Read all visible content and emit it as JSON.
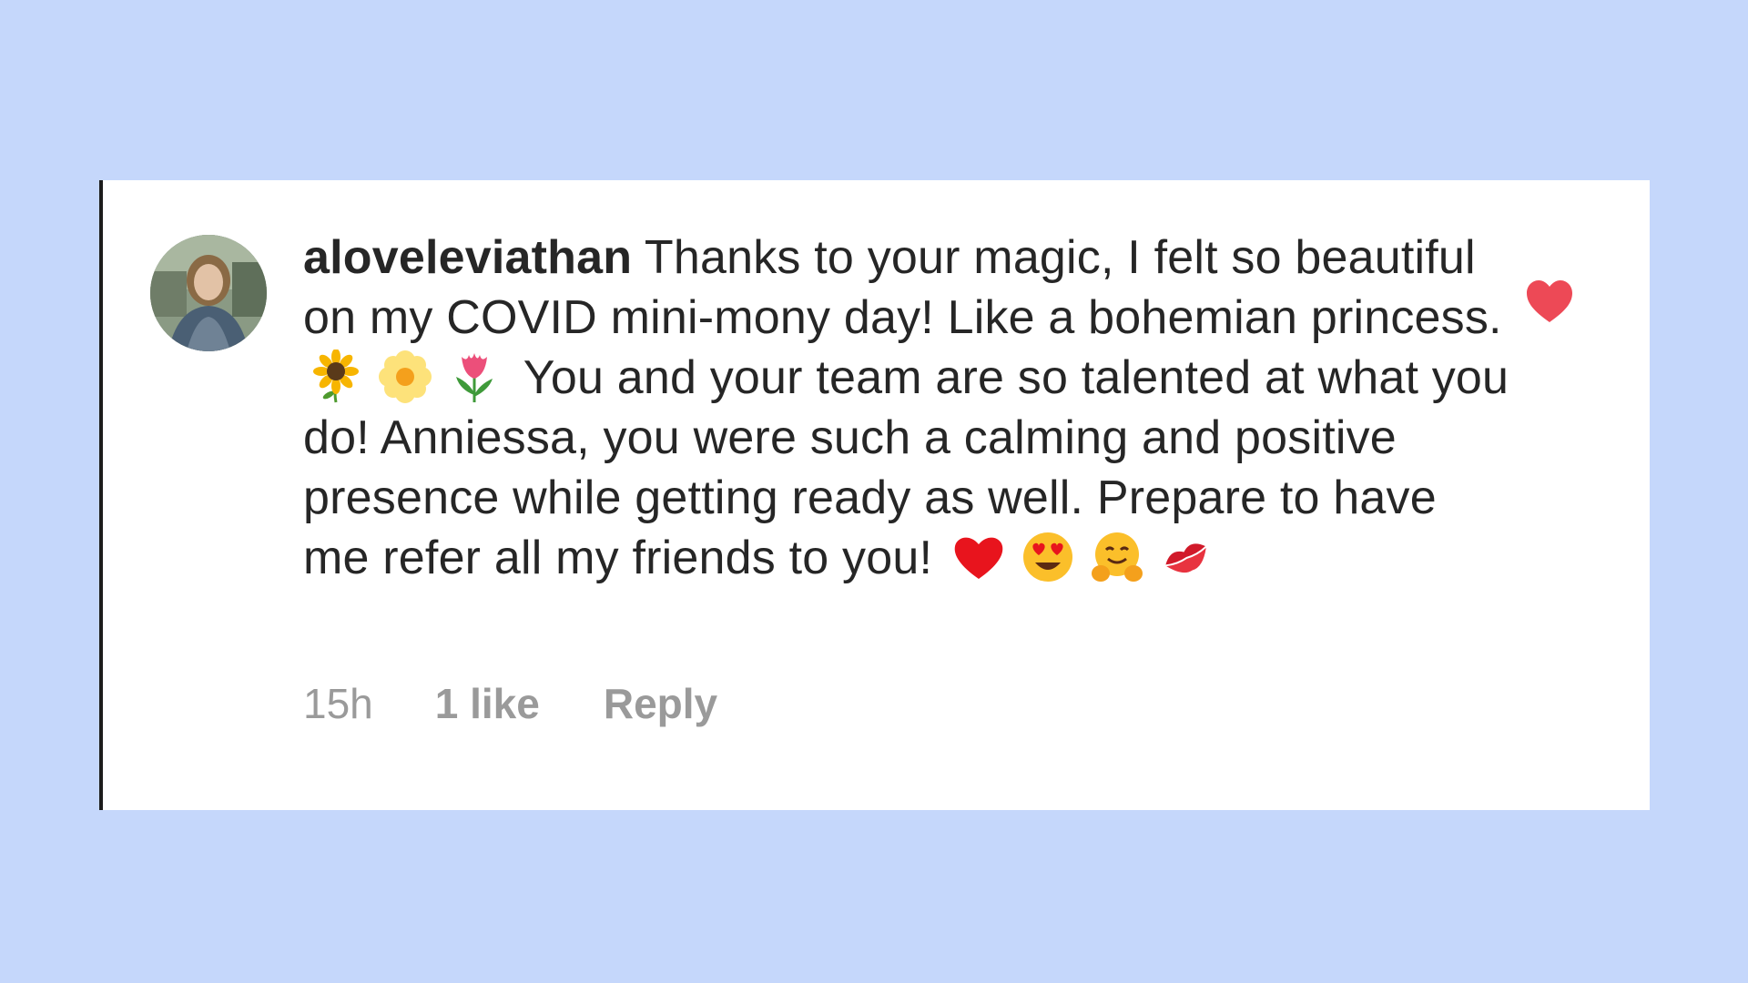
{
  "comment": {
    "username": "aloveleviathan",
    "text_part1": " Thanks to your magic, I felt so beautiful on my COVID mini-mony day! Like a bohemian princess. ",
    "emojis_inline": [
      "sunflower-emoji",
      "blossom-emoji",
      "tulip-emoji"
    ],
    "text_part2": " You and your team are so talented at what you do! Anniessa, you were such a calming and positive presence while getting ready as well. Prepare to have me refer all my friends to you! ",
    "emojis_end": [
      "red-heart-emoji",
      "heart-eyes-emoji",
      "hugging-face-emoji",
      "kiss-mark-emoji"
    ],
    "time": "15h",
    "likes": "1 like",
    "reply_label": "Reply",
    "liked": true
  },
  "colors": {
    "background": "#c5d7fb",
    "card": "#ffffff",
    "text": "#262626",
    "meta": "#9a9a9a",
    "like_heart": "#ed4956"
  }
}
